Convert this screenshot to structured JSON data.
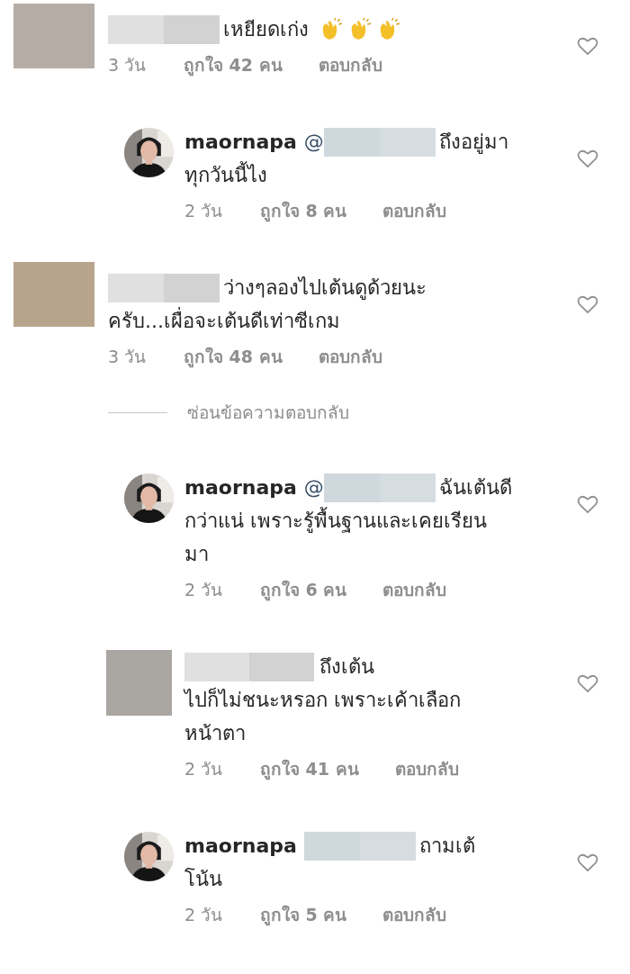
{
  "comments": [
    {
      "kind": "comment",
      "avatar": {
        "kind": "block",
        "color": "#b5aca6"
      },
      "lines": [
        "เหยียดเก่ง"
      ],
      "claps": true,
      "time": "3 วัน",
      "likes": "ถูกใจ 42 คน",
      "reply": "ตอบกลับ"
    },
    {
      "kind": "reply",
      "avatar": {
        "kind": "picture"
      },
      "username": "maornapa",
      "mention": "@",
      "lines": [
        "ถึงอยู่มา",
        "ทุกวันนี้ไง"
      ],
      "time": "2 วัน",
      "likes": "ถูกใจ 8 คน",
      "reply": "ตอบกลับ"
    },
    {
      "kind": "comment",
      "avatar": {
        "kind": "block",
        "color": "#b8a48c"
      },
      "lines": [
        "ว่างๆลองไปเต้นดูด้วยนะ",
        "ครับ...เผื่อจะเต้นดีเท่าซีเกม"
      ],
      "time": "3 วัน",
      "likes": "ถูกใจ 48 คน",
      "reply": "ตอบกลับ"
    },
    {
      "kind": "toggle",
      "label": "ซ่อนข้อความตอบกลับ"
    },
    {
      "kind": "reply",
      "avatar": {
        "kind": "picture"
      },
      "username": "maornapa",
      "mention": "@",
      "lines": [
        "ฉันเต้นดี",
        "กว่าแน่ เพราะรู้พื้นฐานและเคยเรียน",
        "มา"
      ],
      "time": "2 วัน",
      "likes": "ถูกใจ 6 คน",
      "reply": "ตอบกลับ"
    },
    {
      "kind": "reply",
      "avatar": {
        "kind": "block",
        "color": "#aaa7a3"
      },
      "lines": [
        "ถึงเต้น",
        "ไปก็ไม่ชนะหรอก เพราะเค้าเลือก",
        "หน้าตา"
      ],
      "time": "2 วัน",
      "likes": "ถูกใจ 41 คน",
      "reply": "ตอบกลับ"
    },
    {
      "kind": "reply",
      "avatar": {
        "kind": "picture"
      },
      "username": "maornapa",
      "lines": [
        "ถามเต้",
        "โน้น"
      ],
      "time": "2 วัน",
      "likes": "ถูกใจ 5 คน",
      "reply": "ตอบกลับ"
    }
  ]
}
